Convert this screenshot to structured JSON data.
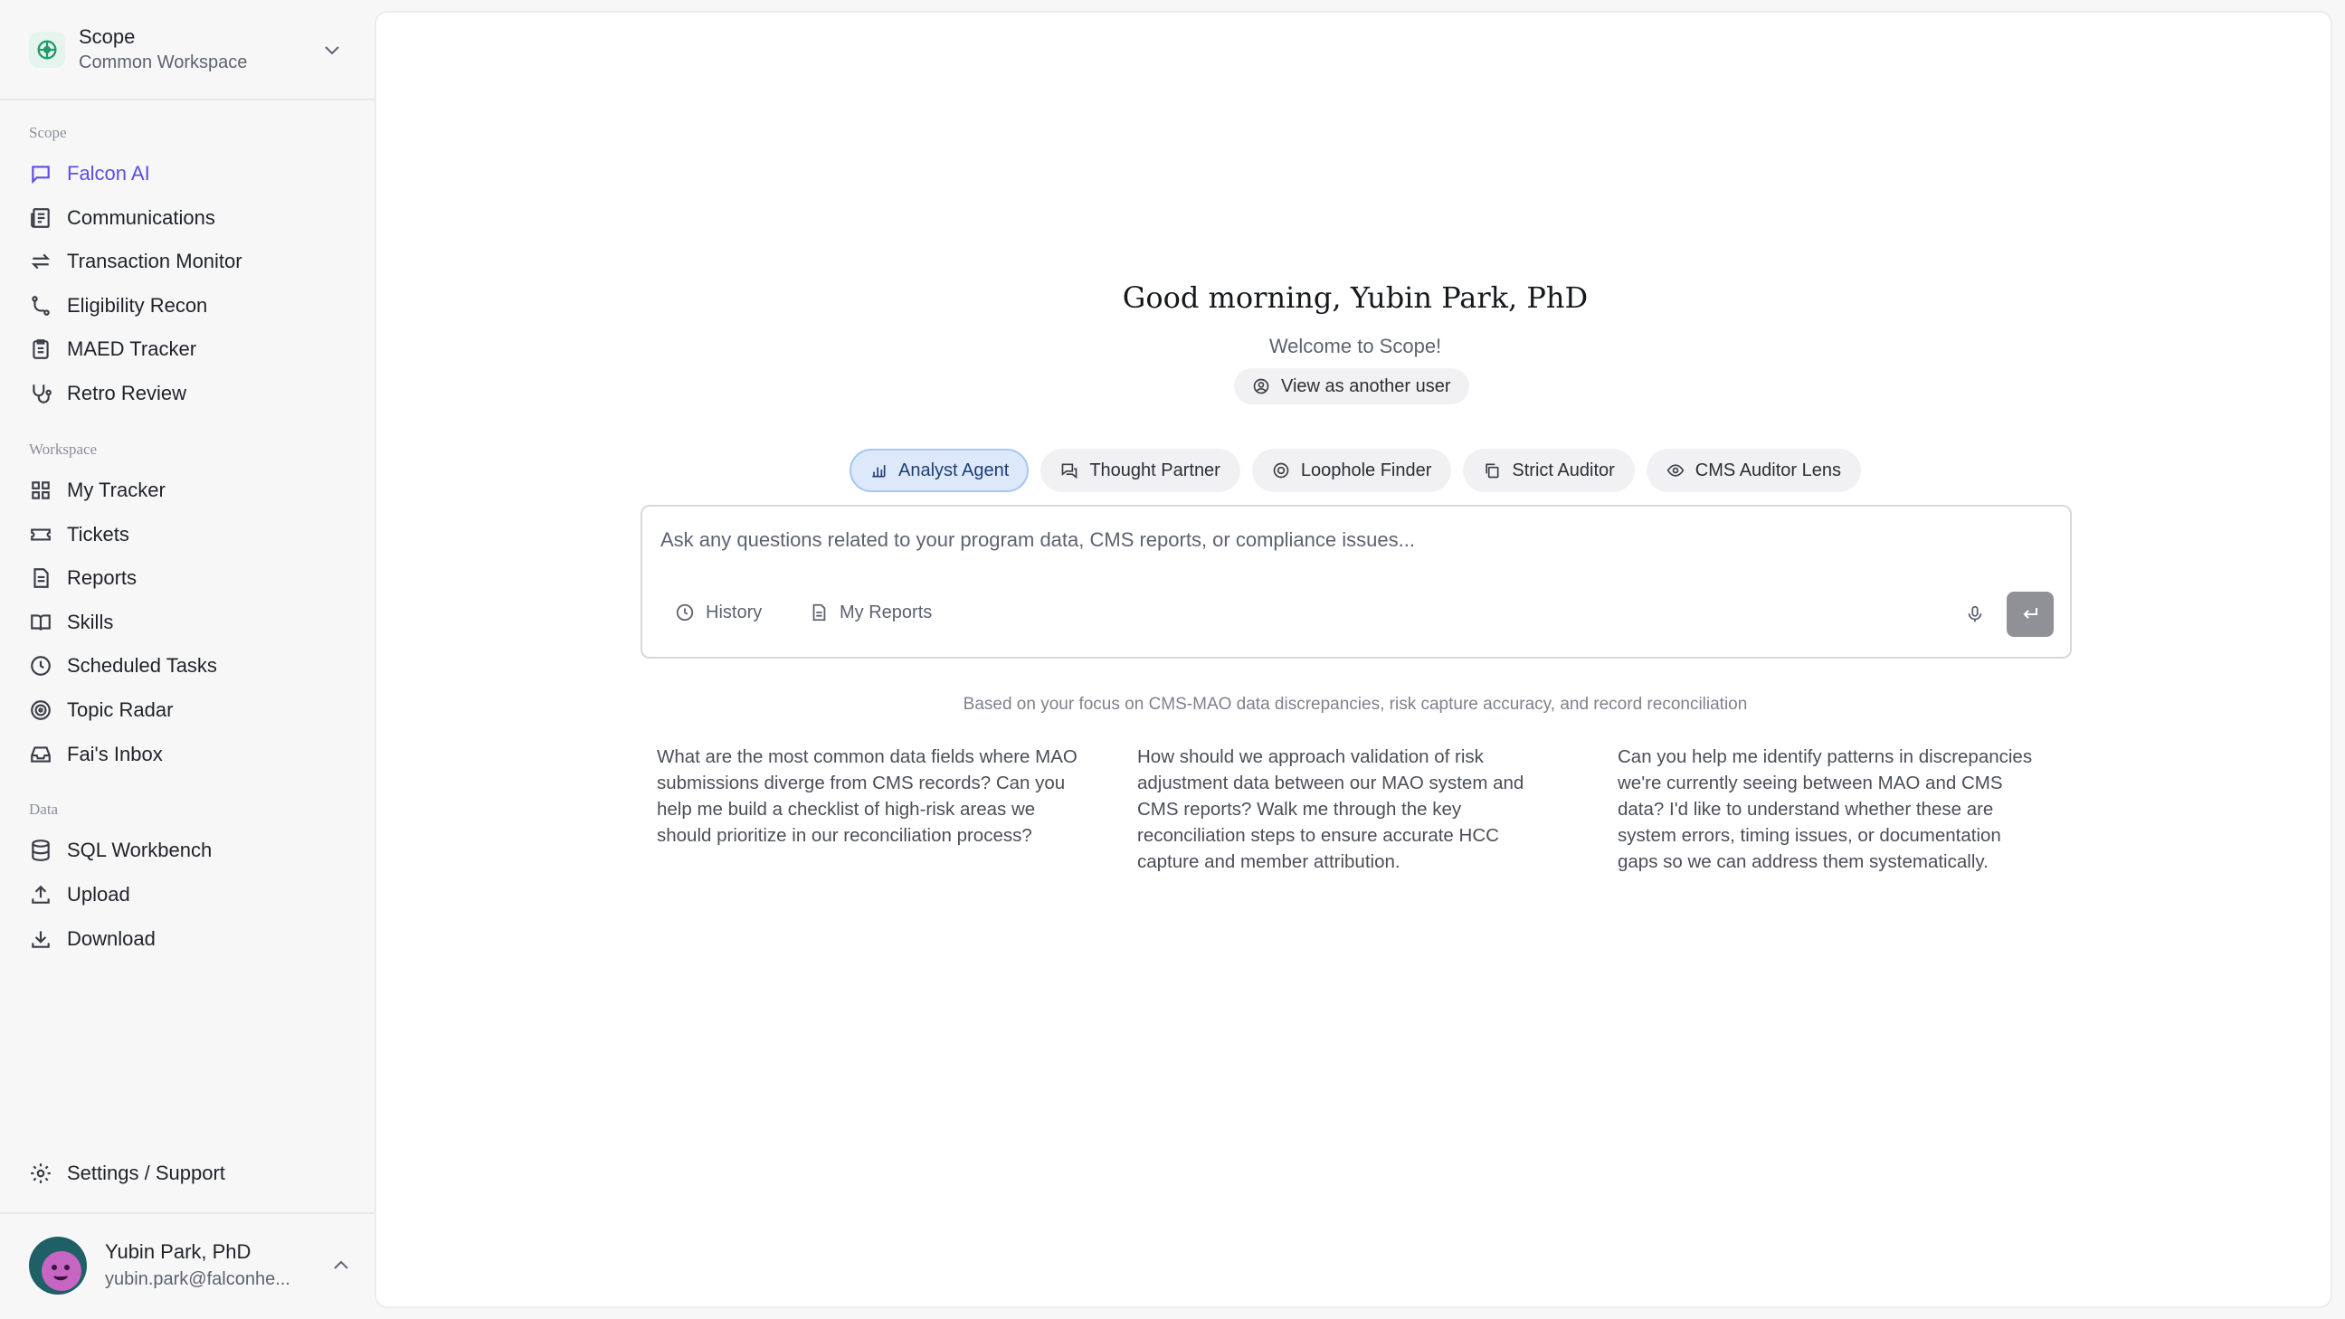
{
  "workspace": {
    "name": "Scope",
    "subtitle": "Common Workspace"
  },
  "sidebar": {
    "sections": [
      {
        "label": "Scope",
        "items": [
          {
            "label": "Falcon AI",
            "icon": "message-square-icon",
            "active": true
          },
          {
            "label": "Communications",
            "icon": "newspaper-icon"
          },
          {
            "label": "Transaction Monitor",
            "icon": "arrows-exchange-icon"
          },
          {
            "label": "Eligibility Recon",
            "icon": "git-branch-icon"
          },
          {
            "label": "MAED Tracker",
            "icon": "clipboard-list-icon"
          },
          {
            "label": "Retro Review",
            "icon": "stethoscope-icon"
          }
        ]
      },
      {
        "label": "Workspace",
        "items": [
          {
            "label": "My Tracker",
            "icon": "grid-icon"
          },
          {
            "label": "Tickets",
            "icon": "ticket-icon"
          },
          {
            "label": "Reports",
            "icon": "file-text-icon"
          },
          {
            "label": "Skills",
            "icon": "book-open-icon"
          },
          {
            "label": "Scheduled Tasks",
            "icon": "clock-icon"
          },
          {
            "label": "Topic Radar",
            "icon": "radar-icon"
          },
          {
            "label": "Fai's Inbox",
            "icon": "inbox-icon"
          }
        ]
      },
      {
        "label": "Data",
        "items": [
          {
            "label": "SQL Workbench",
            "icon": "database-icon"
          },
          {
            "label": "Upload",
            "icon": "upload-icon"
          },
          {
            "label": "Download",
            "icon": "download-icon"
          }
        ]
      }
    ],
    "settings_label": "Settings / Support",
    "user": {
      "name": "Yubin Park, PhD",
      "email": "yubin.park@falconhe..."
    }
  },
  "main": {
    "greeting": "Good morning, Yubin Park, PhD",
    "welcome": "Welcome to Scope!",
    "view_as_label": "View as another user",
    "agents": [
      {
        "label": "Analyst Agent",
        "icon": "bar-chart-icon",
        "active": true
      },
      {
        "label": "Thought Partner",
        "icon": "chat-bubbles-icon"
      },
      {
        "label": "Loophole Finder",
        "icon": "target-icon"
      },
      {
        "label": "Strict Auditor",
        "icon": "copy-icon"
      },
      {
        "label": "CMS Auditor Lens",
        "icon": "eye-icon"
      }
    ],
    "composer": {
      "placeholder": "Ask any questions related to your program data, CMS reports, or compliance issues...",
      "history_label": "History",
      "my_reports_label": "My Reports"
    },
    "focus_note": "Based on your focus on CMS-MAO data discrepancies, risk capture accuracy, and record reconciliation",
    "suggestions": [
      "What are the most common data fields where MAO submissions diverge from CMS records? Can you help me build a checklist of high-risk areas we should prioritize in our reconciliation process?",
      "How should we approach validation of risk adjustment data between our MAO system and CMS reports? Walk me through the key reconciliation steps to ensure accurate HCC capture and member attribution.",
      "Can you help me identify patterns in discrepancies we're currently seeing between MAO and CMS data? I'd like to understand whether these are system errors, timing issues, or documentation gaps so we can address them systematically."
    ]
  },
  "colors": {
    "accent": "#5b4ee6",
    "active_tab_bg": "#dde9fb",
    "send_button": "#8f9197"
  }
}
